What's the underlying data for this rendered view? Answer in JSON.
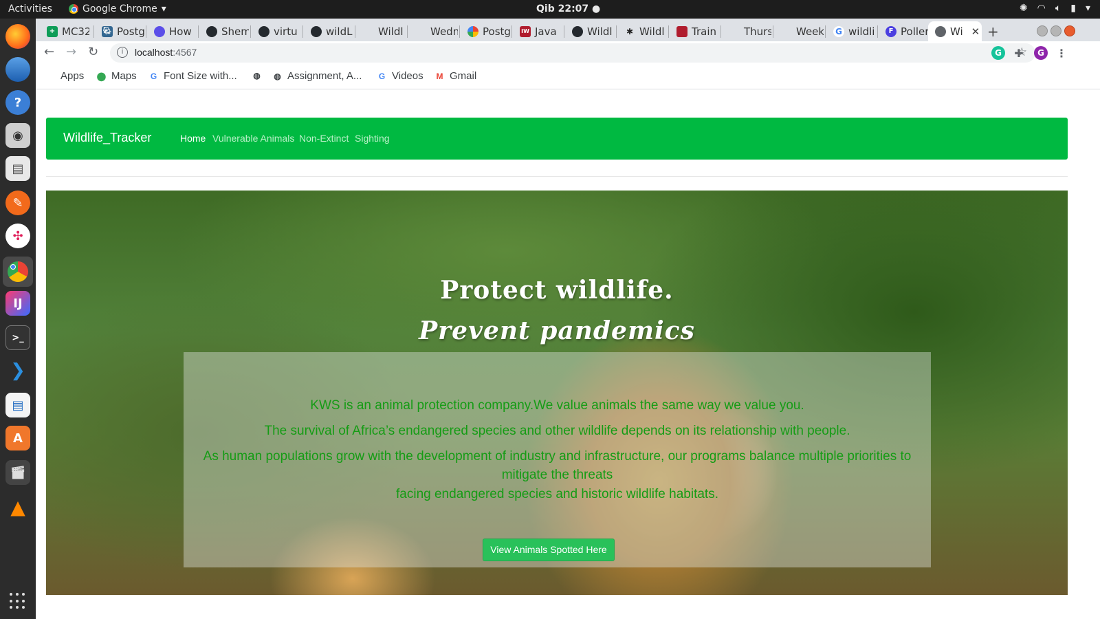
{
  "os": {
    "activities_label": "Activities",
    "app_name": "Google Chrome",
    "clock": "Qib 22:07 ●"
  },
  "tabs": [
    {
      "label": "MC32",
      "icon": "plus-sheet-icon",
      "color": "#0f9d58"
    },
    {
      "label": "Postg",
      "icon": "postgres-icon",
      "color": "#336791"
    },
    {
      "label": "How",
      "icon": "circle-icon",
      "color": "#5b4ee8"
    },
    {
      "label": "Shem",
      "icon": "github-icon",
      "color": "#24292e"
    },
    {
      "label": "virtu",
      "icon": "github-icon",
      "color": "#24292e"
    },
    {
      "label": "wildL",
      "icon": "github-icon",
      "color": "#24292e"
    },
    {
      "label": "Wildl",
      "icon": "page-icon",
      "color": "#dee1e6"
    },
    {
      "label": "Wedn",
      "icon": "page-icon",
      "color": "#dee1e6"
    },
    {
      "label": "Postg",
      "icon": "pinwheel-icon",
      "color": "#ea4335"
    },
    {
      "label": "Java",
      "icon": "iw-icon",
      "color": "#b01c2e"
    },
    {
      "label": "Wildl",
      "icon": "github-icon",
      "color": "#24292e"
    },
    {
      "label": "Wildl",
      "icon": "paw-icon",
      "color": "#222222"
    },
    {
      "label": "Train",
      "icon": "grid-icon",
      "color": "#b01c2e"
    },
    {
      "label": "Thurs",
      "icon": "page-icon",
      "color": "#dee1e6"
    },
    {
      "label": "Week",
      "icon": "page-icon",
      "color": "#dee1e6"
    },
    {
      "label": "wildli",
      "icon": "google-icon",
      "color": "#4285f4"
    },
    {
      "label": "Poller",
      "icon": "f-icon",
      "color": "#4b3fe0"
    },
    {
      "label": "Wi",
      "icon": "globe-icon",
      "color": "#5f6368",
      "active": true
    }
  ],
  "toolbar": {
    "url_host": "localhost",
    "url_port": ":4567"
  },
  "bookmarks": [
    {
      "label": "Apps",
      "icon": "apps-grid-icon"
    },
    {
      "label": "Maps",
      "icon": "maps-pin-icon"
    },
    {
      "label": "Font Size with...",
      "icon": "google-icon"
    },
    {
      "label": "",
      "icon": "globe-icon"
    },
    {
      "label": "Assignment, A...",
      "icon": "globe-icon"
    },
    {
      "label": "Videos",
      "icon": "google-icon"
    },
    {
      "label": "Gmail",
      "icon": "gmail-icon"
    }
  ],
  "navbar": {
    "brand": "Wildlife_Tracker",
    "links": [
      "Home",
      "Vulnerable Animals",
      "Non-Extinct",
      "Sighting"
    ],
    "active_link": "Home",
    "color": "#00b941"
  },
  "hero": {
    "title_line1": "Protect wildlife.",
    "title_line2": "Prevent pandemics",
    "paragraphs": [
      "KWS is an animal protection company.We value animals the same way we value you.",
      "The survival of Africa’s endangered species and other wildlife depends on its relationship with people.",
      "As human populations grow with the development of industry and infrastructure, our programs balance multiple priorities to mitigate the threats",
      "facing endangered species and historic wildlife habitats."
    ],
    "button_label": "View Animals Spotted Here",
    "text_color": "#159c15",
    "button_color": "#29c15a"
  }
}
